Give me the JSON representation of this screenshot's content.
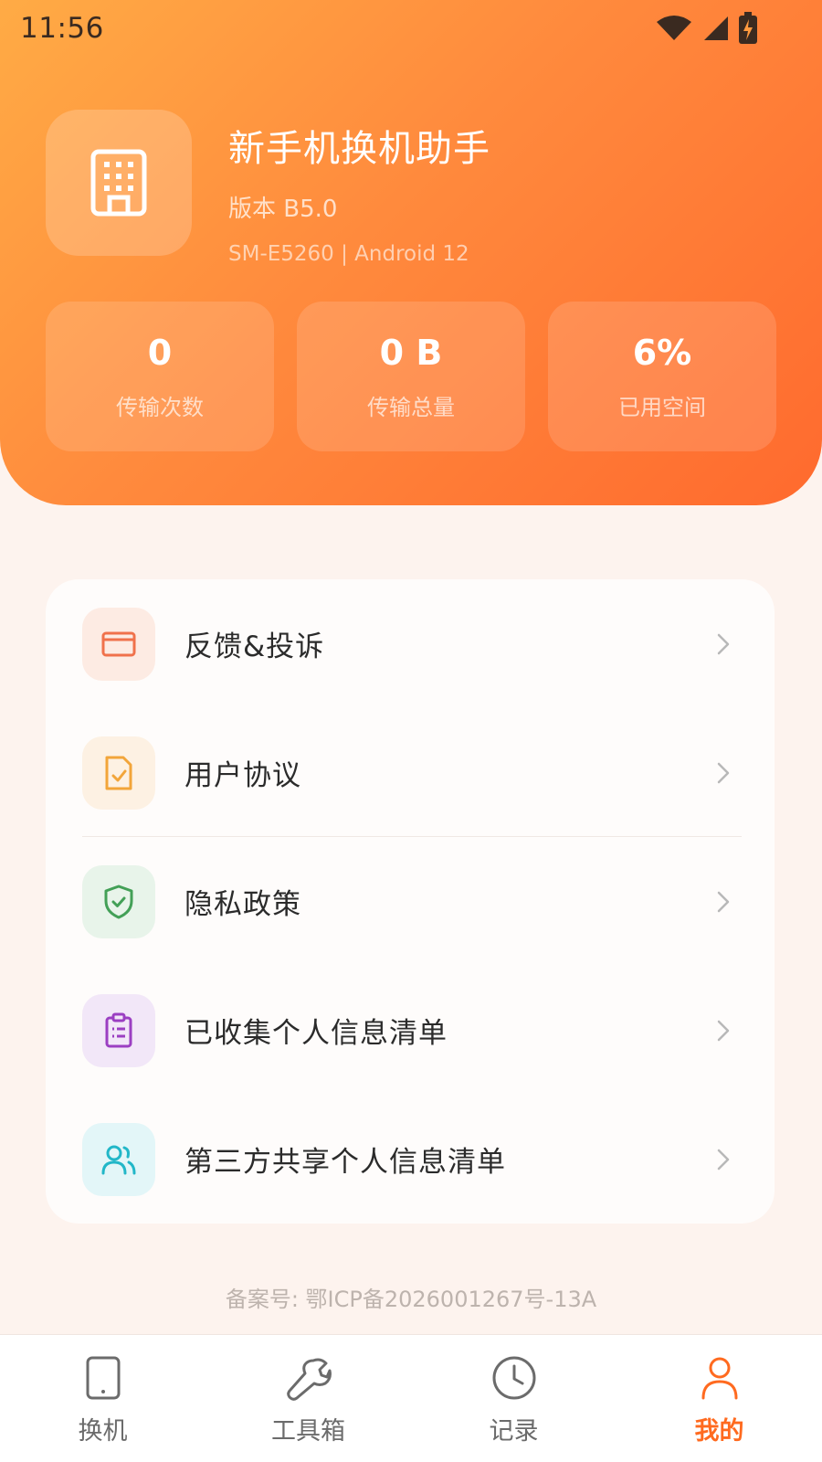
{
  "status_bar": {
    "time": "11:56"
  },
  "app": {
    "title": "新手机换机助手",
    "version": "版本 B5.0",
    "device": "SM-E5260 | Android 12"
  },
  "stats": [
    {
      "value": "0",
      "label": "传输次数"
    },
    {
      "value": "0 B",
      "label": "传输总量"
    },
    {
      "value": "6%",
      "label": "已用空间"
    }
  ],
  "menu": [
    {
      "label": "反馈&投诉",
      "icon": "feedback-icon",
      "color": "#f0714b",
      "bg": "#fdebe3"
    },
    {
      "label": "用户协议",
      "icon": "agreement-icon",
      "color": "#f2a53a",
      "bg": "#fdf1e3"
    },
    {
      "label": "隐私政策",
      "icon": "shield-icon",
      "color": "#43a057",
      "bg": "#e8f4ea"
    },
    {
      "label": "已收集个人信息清单",
      "icon": "clipboard-icon",
      "color": "#9b3fc2",
      "bg": "#f2e7f8"
    },
    {
      "label": "第三方共享个人信息清单",
      "icon": "users-icon",
      "color": "#22b7c8",
      "bg": "#e3f6f8"
    }
  ],
  "icp": "备案号: 鄂ICP备2026001267号-13A",
  "tabs": [
    {
      "label": "换机",
      "icon": "phone-icon"
    },
    {
      "label": "工具箱",
      "icon": "wrench-icon"
    },
    {
      "label": "记录",
      "icon": "clock-icon"
    },
    {
      "label": "我的",
      "icon": "person-icon",
      "active": true
    }
  ],
  "colors": {
    "accent": "#ff6a1f",
    "header_start": "#ffab45",
    "header_end": "#ff6a2e"
  }
}
